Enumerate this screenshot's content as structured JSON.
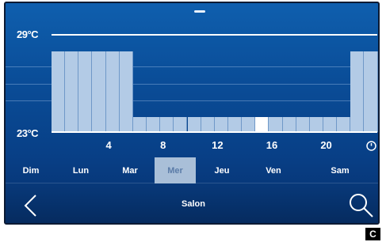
{
  "y_axis": {
    "max_label": "29°C",
    "min_label": "23°C"
  },
  "x_axis": {
    "ticks": [
      "4",
      "8",
      "12",
      "16",
      "20"
    ]
  },
  "schedule": {
    "hours": 24,
    "comfort_hours": [
      0,
      1,
      2,
      3,
      4,
      5,
      22,
      23
    ],
    "current_hour": 15
  },
  "days": [
    "Dim",
    "Lun",
    "Mar",
    "Mer",
    "Jeu",
    "Ven",
    "Sam"
  ],
  "selected_day": "Mer",
  "footer": {
    "room": "Salon"
  },
  "panel_letter": "C",
  "icons": [
    "clock-icon",
    "back-icon",
    "search-icon"
  ],
  "colors": {
    "bar": "#b3cbe6",
    "current_hour": "#ffffff",
    "selected_day": "#a9bfd8"
  }
}
